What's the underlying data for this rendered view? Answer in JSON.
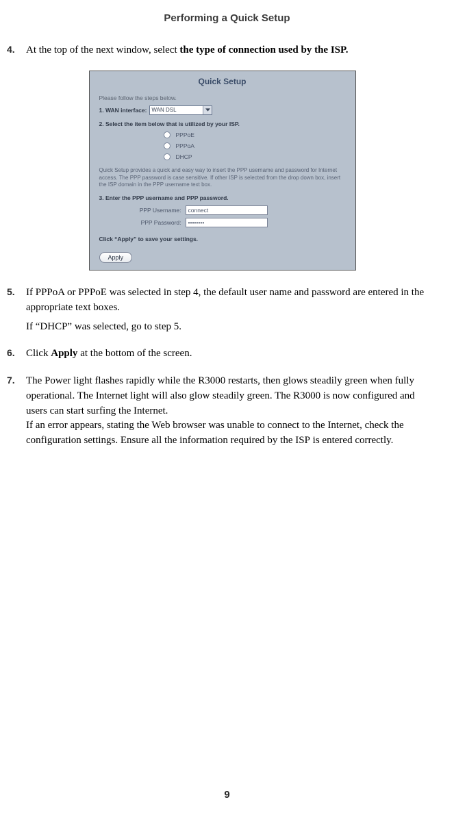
{
  "header": {
    "title": "Performing a Quick Setup"
  },
  "steps": {
    "s4": {
      "num": "4.",
      "text_a": "At the top of the next window, select ",
      "text_b": "the type of connection used by the ISP."
    },
    "s5": {
      "num": "5.",
      "p1": "If PPPoA or PPPoE was selected in step 4,  the default user name and password are entered in the appropriate text boxes.",
      "p2": "If “DHCP” was selected, go to step 5."
    },
    "s6": {
      "num": "6.",
      "text_a": "Click ",
      "text_b": "Apply",
      "text_c": " at the bottom of the screen."
    },
    "s7": {
      "num": "7.",
      "p1a": "The Power light flashes rapidly while the R3000 restarts, then glows steadily green when fully operational. The Internet light will also glow steadily green. The R3000 is now configured and users can start surfing the Internet.",
      "p1b": "If an error appears, stating the Web browser was unable to connect to the Internet, check the configuration settings. Ensure all the information required by the ",
      "p1c": "ISP",
      "p1d": " is entered correctly."
    }
  },
  "panel": {
    "title": "Quick Setup",
    "follow": "Please follow the steps below.",
    "wan_label": "1. WAN interface:",
    "wan_value": "WAN DSL",
    "sec2": "2. Select the item below that is utilized by your ISP.",
    "radios": {
      "opt1": "PPPoE",
      "opt2": "PPPoA",
      "opt3": "DHCP"
    },
    "desc": "Quick Setup provides a quick and easy way to insert the PPP username and password for Internet access. The PPP password is case sensitive. If other ISP is selected from the drop down box, insert the ISP domain in the PPP username text box.",
    "sec3": "3. Enter the PPP username and PPP password.",
    "user_label": "PPP Username:",
    "user_value": "connect",
    "pass_label": "PPP Password:",
    "pass_value": "••••••••",
    "click_apply": "Click “Apply” to save your settings.",
    "apply": "Apply"
  },
  "page_number": "9"
}
